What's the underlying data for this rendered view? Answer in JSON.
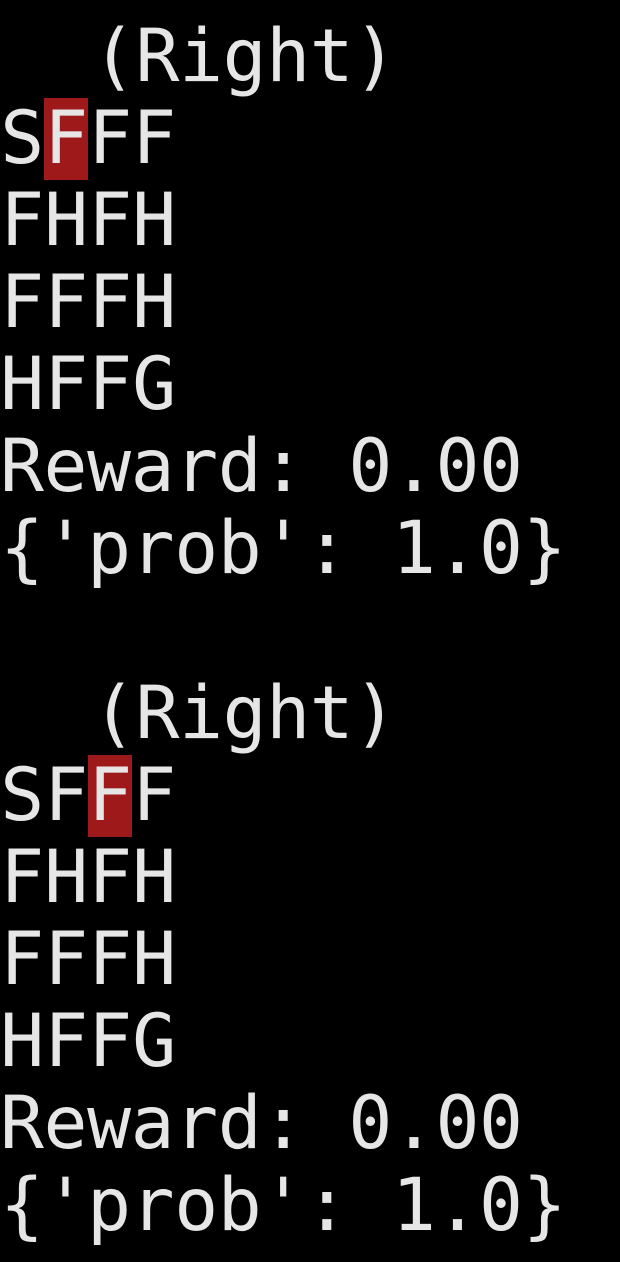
{
  "steps": [
    {
      "action": "(Right)",
      "grid": [
        [
          "S",
          "F",
          "F",
          "F"
        ],
        [
          "F",
          "H",
          "F",
          "H"
        ],
        [
          "F",
          "F",
          "F",
          "H"
        ],
        [
          "H",
          "F",
          "F",
          "G"
        ]
      ],
      "agent_position": {
        "row": 0,
        "col": 1
      },
      "reward": "Reward: 0.00",
      "info": "{'prob': 1.0}"
    },
    {
      "action": "(Right)",
      "grid": [
        [
          "S",
          "F",
          "F",
          "F"
        ],
        [
          "F",
          "H",
          "F",
          "H"
        ],
        [
          "F",
          "F",
          "F",
          "H"
        ],
        [
          "H",
          "F",
          "F",
          "G"
        ]
      ],
      "agent_position": {
        "row": 0,
        "col": 2
      },
      "reward": "Reward: 0.00",
      "info": "{'prob': 1.0}"
    }
  ],
  "colors": {
    "background": "#000000",
    "text": "#e6e6e6",
    "agent_highlight": "#9e1a1a"
  }
}
